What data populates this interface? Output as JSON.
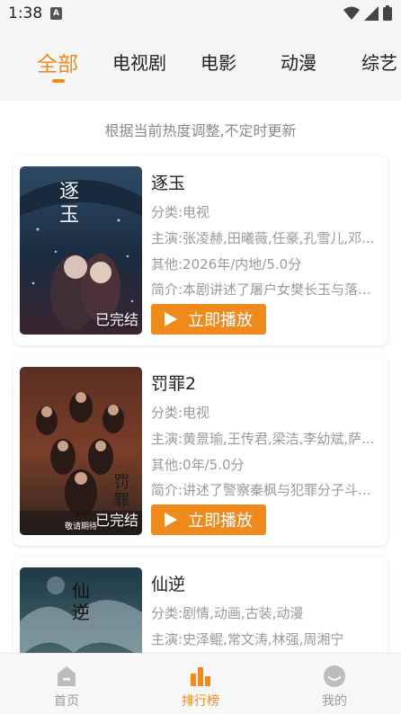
{
  "status": {
    "time": "1:38",
    "a_badge": "A"
  },
  "tabs": [
    {
      "label": "全部",
      "active": true
    },
    {
      "label": "电视剧"
    },
    {
      "label": "电影"
    },
    {
      "label": "动漫"
    },
    {
      "label": "综艺"
    }
  ],
  "hint": "根据当前热度调整,不定时更新",
  "items": [
    {
      "title": "逐玉",
      "category": "分类:电视",
      "cast": "主演:张凌赫,田曦薇,任豪,孔雪儿,邓...",
      "other": "其他:2026年/内地/5.0分",
      "intro": "简介:本剧讲述了屠户女樊长玉与落...",
      "badge": "已完结",
      "play_label": "立即播放",
      "poster_text": "逐玉"
    },
    {
      "title": "罚罪2",
      "category": "分类:电视",
      "cast": "主演:黄景瑜,王传君,梁洁,李幼斌,萨...",
      "other": "其他:0年/5.0分",
      "intro": "简介:讲述了警察秦枫与犯罪分子斗...",
      "badge": "已完结",
      "play_label": "立即播放",
      "poster_text": "罚罪",
      "poster_sub": "敬请期待"
    },
    {
      "title": "仙逆",
      "category": "分类:剧情,动画,古装,动漫",
      "cast": "主演:史泽鲲,常文涛,林强,周湘宁",
      "poster_text": "仙逆"
    }
  ],
  "nav": [
    {
      "label": "首页",
      "icon": "home-icon"
    },
    {
      "label": "排行榜",
      "icon": "ranking-icon",
      "active": true
    },
    {
      "label": "我的",
      "icon": "profile-icon"
    }
  ],
  "colors": {
    "accent": "#f08a1c",
    "muted": "#9a9a9a"
  }
}
